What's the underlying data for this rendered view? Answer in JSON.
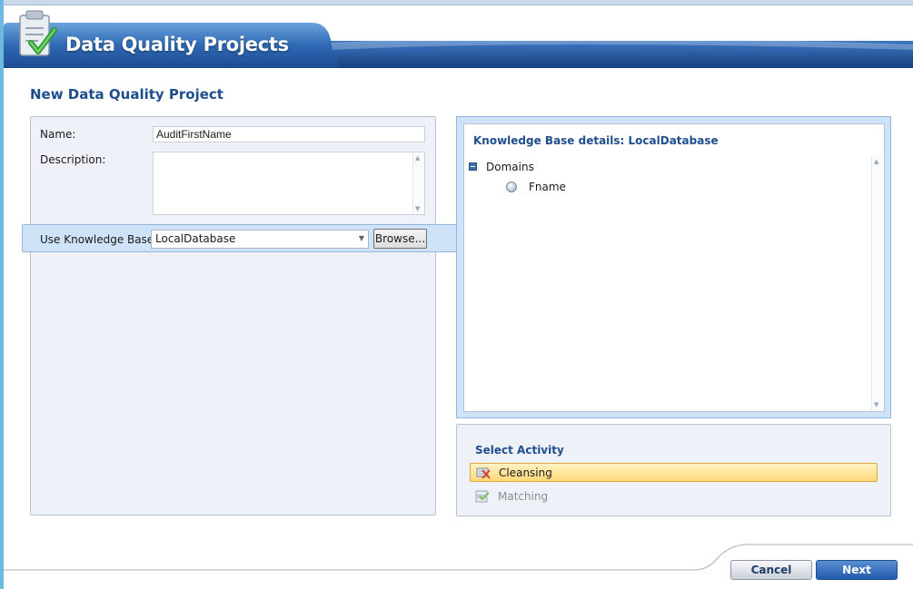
{
  "header": {
    "title": "Data Quality Projects"
  },
  "page": {
    "title": "New Data Quality Project"
  },
  "form": {
    "name_label": "Name:",
    "name_value": "AuditFirstName",
    "description_label": "Description:",
    "description_value": "",
    "kb_label": "Use Knowledge Base:",
    "kb_value": "LocalDatabase",
    "browse_label": "Browse..."
  },
  "kb_details": {
    "title": "Knowledge Base details: LocalDatabase",
    "tree_root": "Domains",
    "domains": [
      "Fname"
    ]
  },
  "activity": {
    "title": "Select Activity",
    "items": [
      {
        "label": "Cleansing",
        "selected": true,
        "icon": "cleansing-icon"
      },
      {
        "label": "Matching",
        "selected": false,
        "disabled": true,
        "icon": "matching-icon"
      }
    ]
  },
  "footer": {
    "cancel_label": "Cancel",
    "next_label": "Next"
  },
  "colors": {
    "accent": "#1f4e8c",
    "selection": "#ffd97a",
    "band": "#cfe3f8"
  }
}
